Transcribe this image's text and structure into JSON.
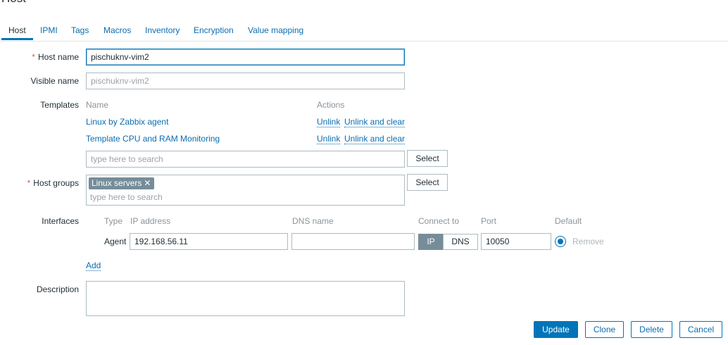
{
  "page": {
    "title": "Host"
  },
  "tabs": [
    "Host",
    "IPMI",
    "Tags",
    "Macros",
    "Inventory",
    "Encryption",
    "Value mapping"
  ],
  "form": {
    "host_name": {
      "label": "Host name",
      "value": "pischuknv-vim2"
    },
    "visible_name": {
      "label": "Visible name",
      "placeholder": "pischuknv-vim2"
    },
    "templates": {
      "label": "Templates",
      "col_name": "Name",
      "col_actions": "Actions",
      "rows": [
        {
          "name": "Linux by Zabbix agent",
          "unlink": "Unlink",
          "unlink_clear": "Unlink and clear"
        },
        {
          "name": "Template CPU and RAM Monitoring",
          "unlink": "Unlink",
          "unlink_clear": "Unlink and clear"
        }
      ],
      "search_placeholder": "type here to search",
      "select_label": "Select"
    },
    "host_groups": {
      "label": "Host groups",
      "chip": "Linux servers",
      "chip_remove": "✕",
      "search_placeholder": "type here to search",
      "select_label": "Select"
    },
    "interfaces": {
      "label": "Interfaces",
      "headers": {
        "type": "Type",
        "ip": "IP address",
        "dns": "DNS name",
        "connect": "Connect to",
        "port": "Port",
        "default": "Default"
      },
      "row": {
        "type": "Agent",
        "ip": "192.168.56.11",
        "dns": "",
        "connect_ip": "IP",
        "connect_dns": "DNS",
        "port": "10050",
        "remove": "Remove"
      },
      "add_label": "Add"
    },
    "description": {
      "label": "Description",
      "value": ""
    }
  },
  "actions": {
    "update": "Update",
    "clone": "Clone",
    "delete": "Delete",
    "cancel": "Cancel"
  },
  "colors": {
    "accent": "#0275b8",
    "required": "#e45959",
    "chip": "#768d99"
  }
}
